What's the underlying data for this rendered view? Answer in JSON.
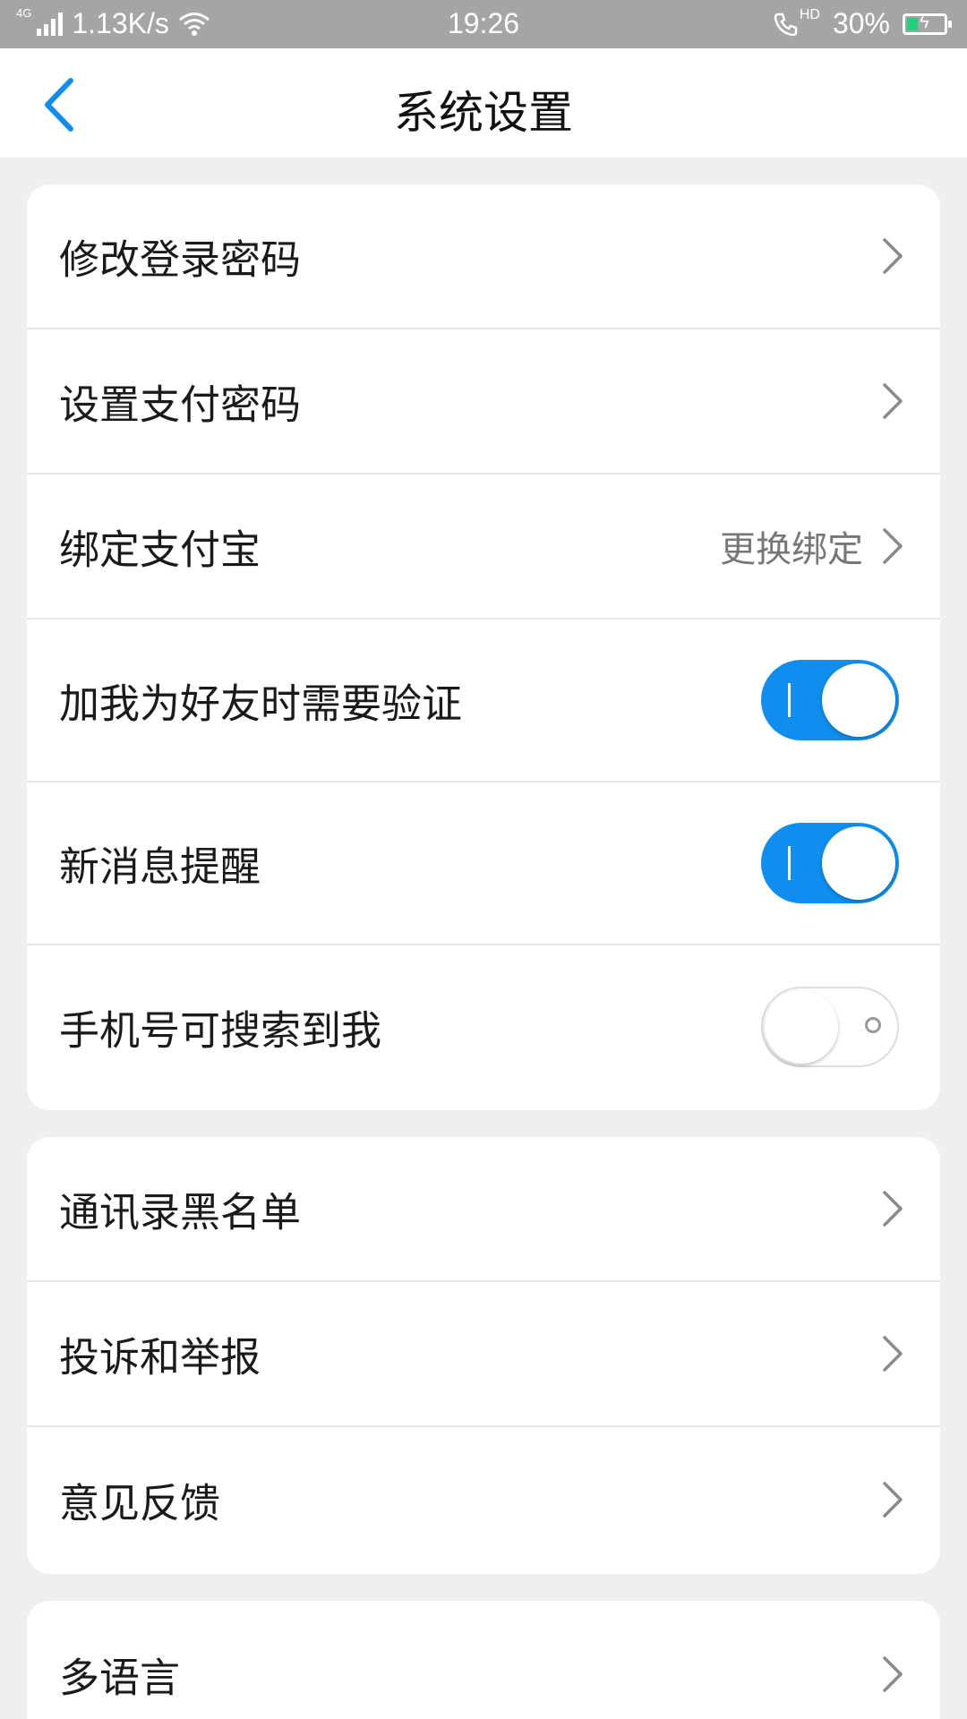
{
  "status_bar": {
    "network": "4G",
    "speed": "1.13K/s",
    "time": "19:26",
    "call_label": "HD",
    "battery": "30%",
    "battery_level": 0.3,
    "battery_color": "#22d27a"
  },
  "header": {
    "title": "系统设置",
    "back_icon": "chevron-left-icon",
    "accent": "#0f8ef0"
  },
  "group1": [
    {
      "label": "修改登录密码",
      "type": "link"
    },
    {
      "label": "设置支付密码",
      "type": "link"
    },
    {
      "label": "绑定支付宝",
      "value": "更换绑定",
      "type": "link"
    },
    {
      "label": "加我为好友时需要验证",
      "type": "toggle",
      "on": true
    },
    {
      "label": "新消息提醒",
      "type": "toggle",
      "on": true
    },
    {
      "label": "手机号可搜索到我",
      "type": "toggle",
      "on": false
    }
  ],
  "group2": [
    {
      "label": "通讯录黑名单",
      "type": "link"
    },
    {
      "label": "投诉和举报",
      "type": "link"
    },
    {
      "label": "意见反馈",
      "type": "link"
    }
  ],
  "group3": [
    {
      "label": "多语言",
      "type": "link"
    }
  ]
}
